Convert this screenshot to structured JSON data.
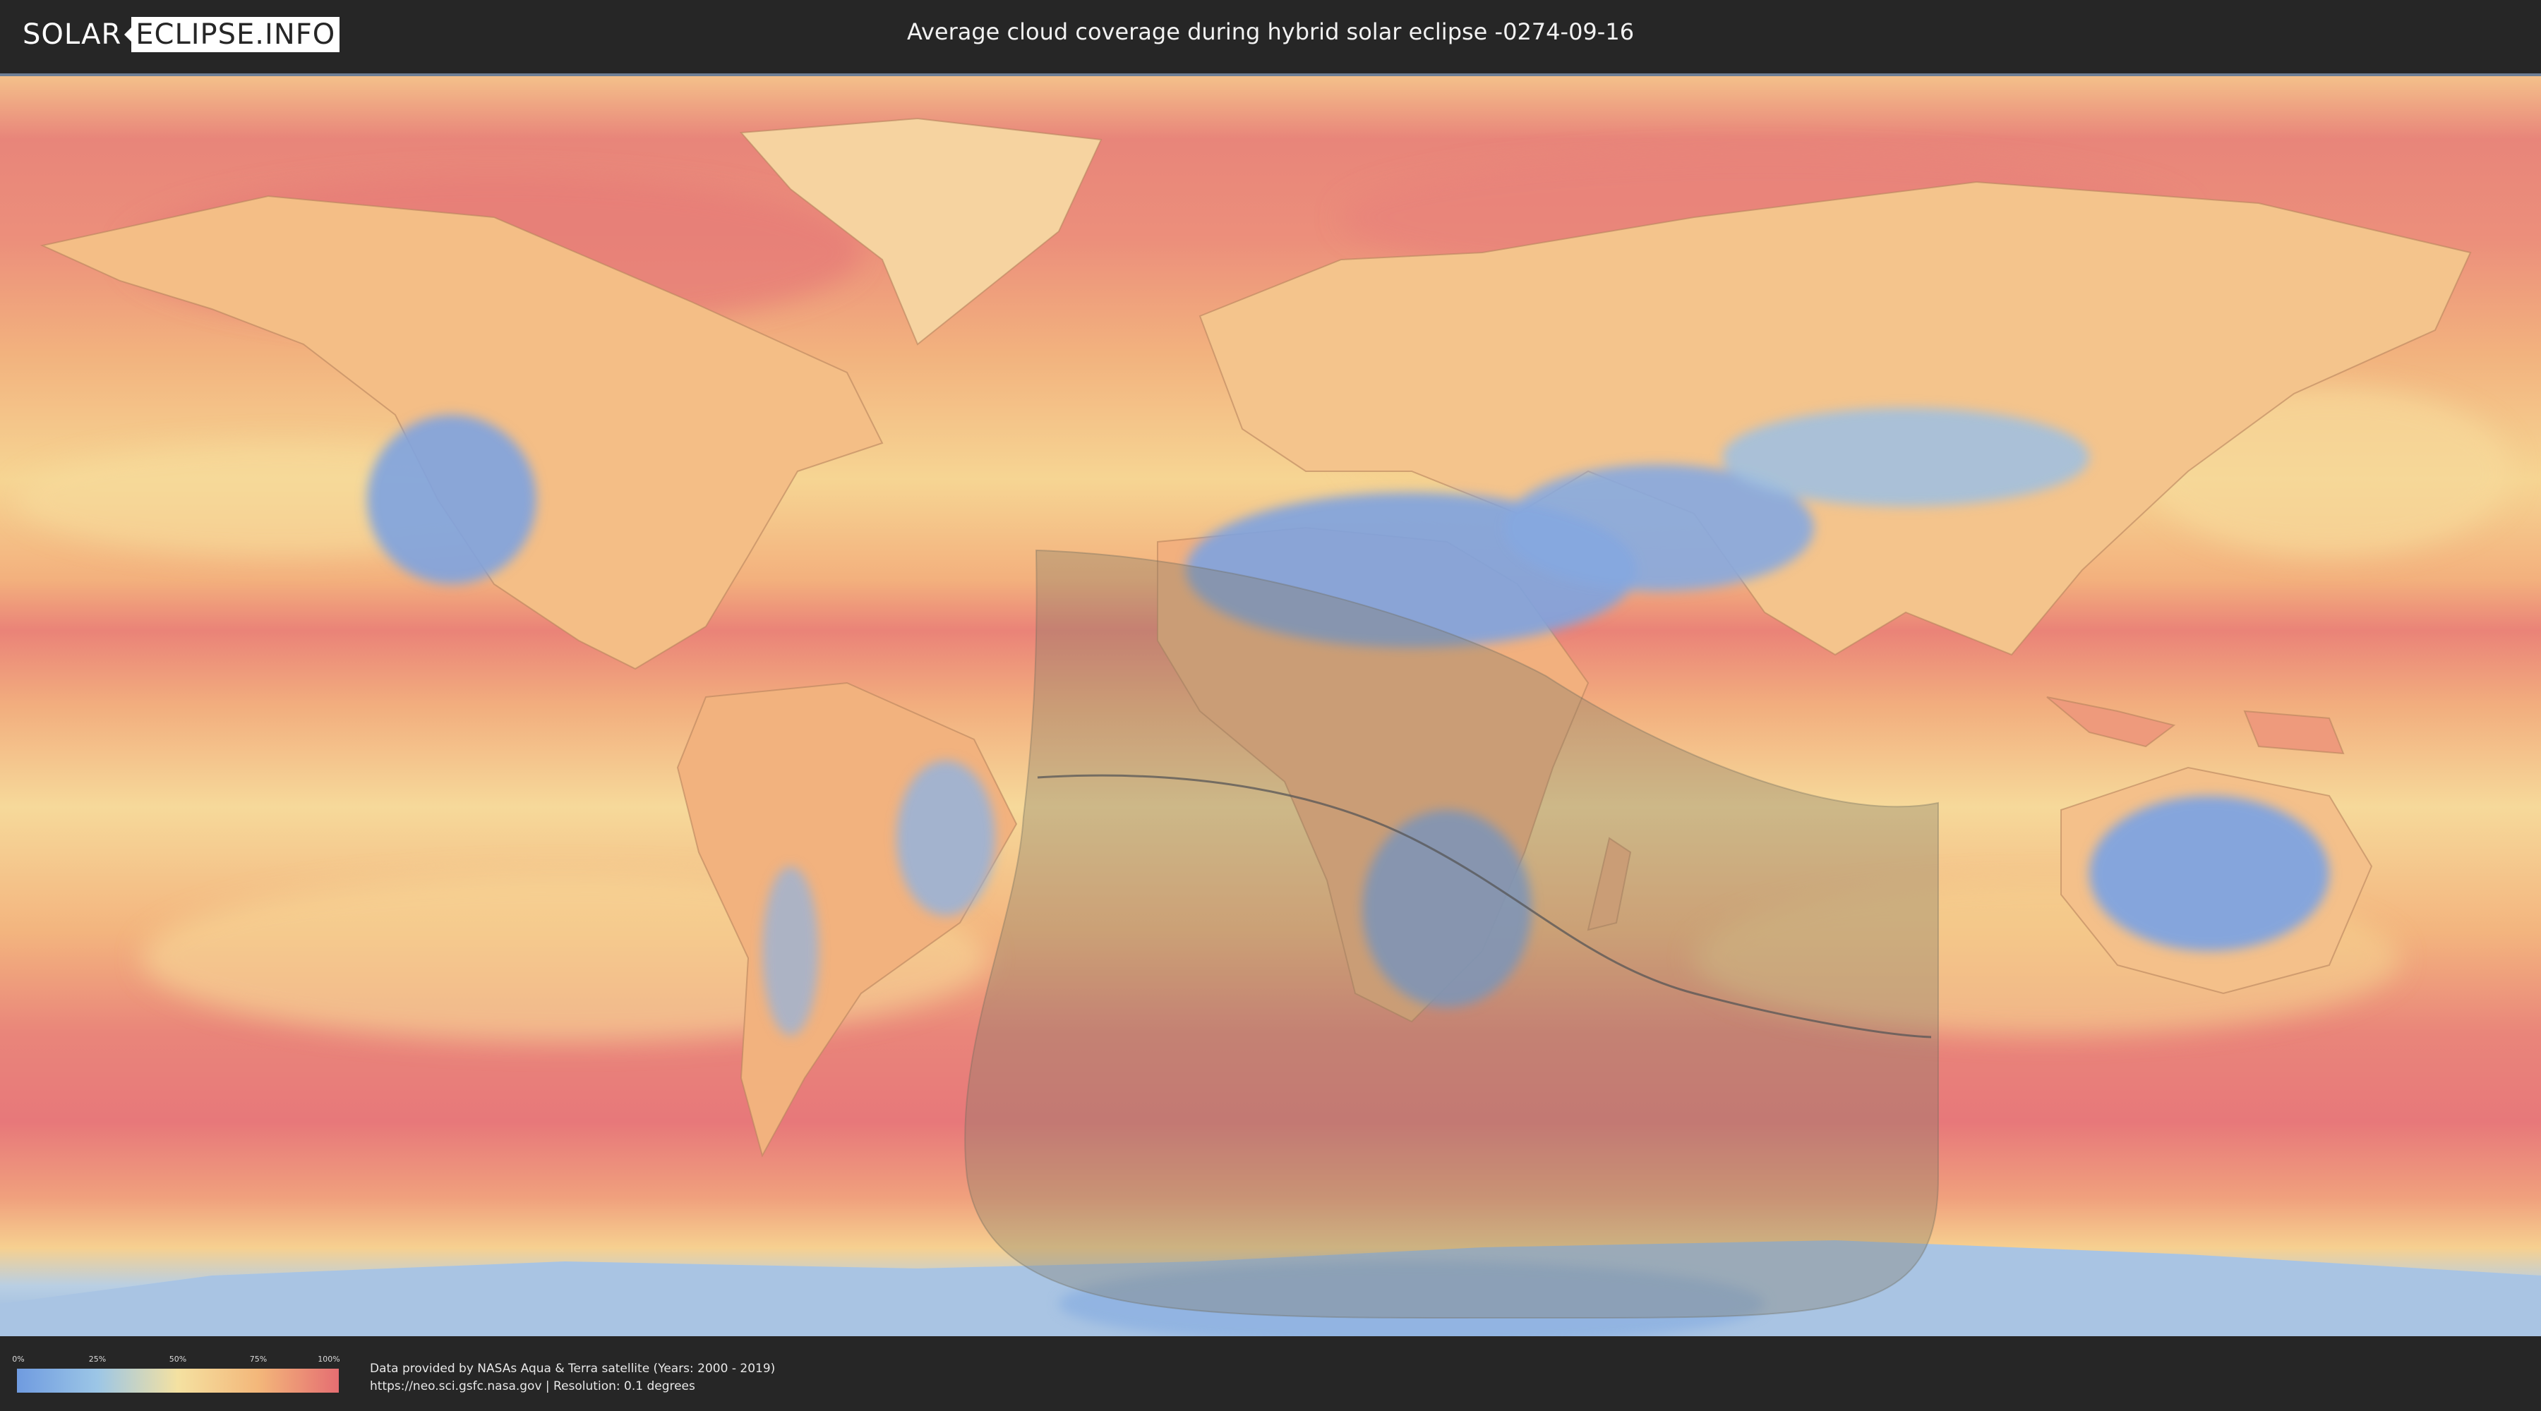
{
  "header": {
    "logo_part1": "SOLAR",
    "logo_part2": "ECLIPSE.INFO",
    "title": "Average cloud coverage during hybrid solar eclipse -0274-09-16"
  },
  "legend": {
    "ticks": [
      "0%",
      "25%",
      "50%",
      "75%",
      "100%"
    ],
    "colors": [
      "#6f9be0",
      "#9cc6e6",
      "#f4e1a1",
      "#f3b77a",
      "#e56e72"
    ]
  },
  "footer": {
    "credit_line1": "Data provided by NASAs Aqua & Terra satellite (Years: 2000 - 2019)",
    "credit_line2": "https://neo.sci.gsfc.nasa.gov | Resolution: 0.1 degrees"
  },
  "map": {
    "colors": {
      "ocean_cloudy": "#e8807a",
      "ocean_mid": "#f2b27e",
      "land_clear": "#7ea3e0",
      "eclipse_overlay": "#807a68",
      "eclipse_path": "#555555"
    }
  }
}
